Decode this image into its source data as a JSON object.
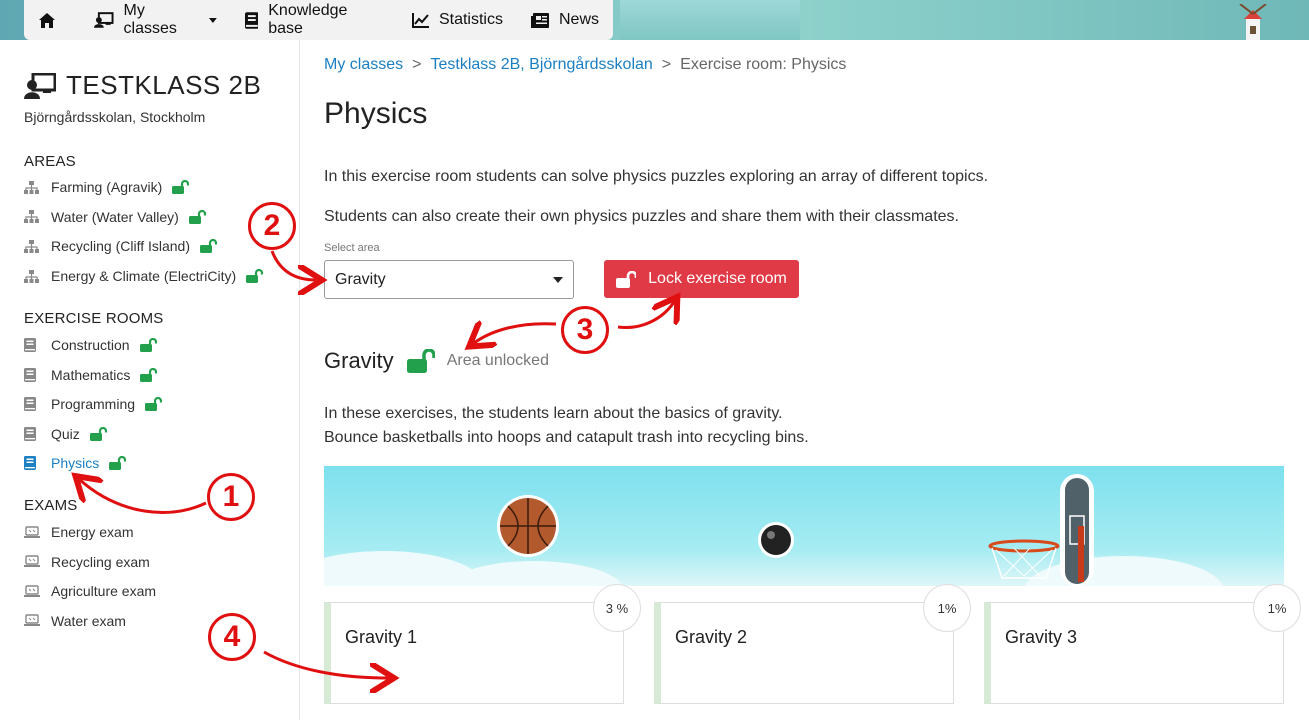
{
  "nav": {
    "home_icon": "home-icon",
    "items": [
      {
        "label": "My classes",
        "icon": "classroom-icon",
        "dropdown": true
      },
      {
        "label": "Knowledge base",
        "icon": "book-icon"
      },
      {
        "label": "Statistics",
        "icon": "chart-line-icon"
      },
      {
        "label": "News",
        "icon": "newspaper-icon"
      }
    ]
  },
  "sidebar": {
    "class_title": "TESTKLASS 2B",
    "school": "Björngårdsskolan, Stockholm",
    "areas_heading": "AREAS",
    "areas": [
      {
        "label": "Farming (Agravik)"
      },
      {
        "label": "Water (Water Valley)"
      },
      {
        "label": "Recycling (Cliff Island)"
      },
      {
        "label": "Energy & Climate (ElectriCity)"
      }
    ],
    "rooms_heading": "EXERCISE ROOMS",
    "rooms": [
      {
        "label": "Construction"
      },
      {
        "label": "Mathematics"
      },
      {
        "label": "Programming"
      },
      {
        "label": "Quiz"
      },
      {
        "label": "Physics",
        "active": true
      }
    ],
    "exams_heading": "EXAMS",
    "exams": [
      {
        "label": "Energy exam"
      },
      {
        "label": "Recycling exam"
      },
      {
        "label": "Agriculture exam"
      },
      {
        "label": "Water exam"
      }
    ]
  },
  "breadcrumb": {
    "crumb1": "My classes",
    "crumb2": "Testklass 2B, Björngårdsskolan",
    "crumb3": "Exercise room: Physics",
    "separator": ">"
  },
  "main": {
    "title": "Physics",
    "intro1": "In this exercise room students can solve physics puzzles exploring an array of different topics.",
    "intro2": "Students can also create their own physics puzzles and share them with their classmates.",
    "select_label": "Select area",
    "select_value": "Gravity",
    "lock_button": "Lock exercise room",
    "area_title": "Gravity",
    "area_status": "Area unlocked",
    "desc1": "In these exercises, the students learn about the basics of gravity.",
    "desc2": "Bounce basketballs into hoops and catapult trash into recycling bins.",
    "cards": [
      {
        "title": "Gravity 1",
        "percent": "3 %"
      },
      {
        "title": "Gravity 2",
        "percent": "1%"
      },
      {
        "title": "Gravity 3",
        "percent": "1%"
      }
    ]
  },
  "annotations": {
    "m1": "1",
    "m2": "2",
    "m3": "3",
    "m4": "4"
  },
  "colors": {
    "accent_blue": "#1b7fc2",
    "lock_green": "#22a04b",
    "lock_red": "#e03a46",
    "annotation_red": "#e01010"
  }
}
